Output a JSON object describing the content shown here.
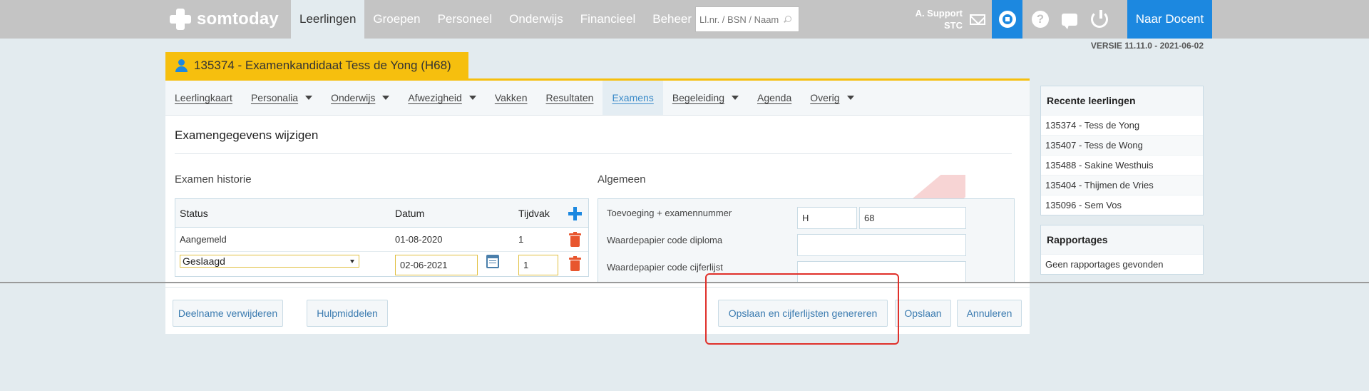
{
  "app": {
    "logo_text": "somtoday",
    "version": "VERSIE 11.11.0 - 2021-06-02"
  },
  "nav": {
    "items": [
      {
        "label": "Leerlingen",
        "active": true
      },
      {
        "label": "Groepen"
      },
      {
        "label": "Personeel"
      },
      {
        "label": "Onderwijs"
      },
      {
        "label": "Financieel"
      },
      {
        "label": "Beheer"
      }
    ]
  },
  "search": {
    "placeholder": "Ll.nr. / BSN / Naam"
  },
  "user": {
    "name": "A. Support",
    "org": "STC"
  },
  "docent_button": "Naar Docent",
  "icons": [
    "mail-icon",
    "gear-icon",
    "help-icon",
    "chat-icon",
    "power-icon",
    "person-icon",
    "plus-icon",
    "trash-icon",
    "calendar-icon"
  ],
  "colors": {
    "accent": "#1c88e0",
    "tab_yellow": "#f6bf0e",
    "delete_red": "#e8562e",
    "highlight_red": "#e0302a"
  },
  "student_tab": "135374 - Examenkandidaat Tess de Yong (H68)",
  "subnav": [
    {
      "label": "Leerlingkaart"
    },
    {
      "label": "Personalia",
      "dropdown": true
    },
    {
      "label": "Onderwijs",
      "dropdown": true
    },
    {
      "label": "Afwezigheid",
      "dropdown": true
    },
    {
      "label": "Vakken"
    },
    {
      "label": "Resultaten"
    },
    {
      "label": "Examens",
      "active": true
    },
    {
      "label": "Begeleiding",
      "dropdown": true
    },
    {
      "label": "Agenda"
    },
    {
      "label": "Overig",
      "dropdown": true
    }
  ],
  "page_title": "Examengegevens wijzigen",
  "history": {
    "title": "Examen historie",
    "headers": {
      "status": "Status",
      "datum": "Datum",
      "tijdvak": "Tijdvak"
    },
    "rows": [
      {
        "status": "Aangemeld",
        "datum": "01-08-2020",
        "tijdvak": "1"
      }
    ],
    "edit_row": {
      "status": "Geslaagd",
      "datum": "02-06-2021",
      "tijdvak": "1"
    }
  },
  "algemeen": {
    "title": "Algemeen",
    "fields": [
      {
        "label": "Toevoeging + examennummer",
        "value1": "H",
        "value2": "68"
      },
      {
        "label": "Waardepapier code diploma",
        "value": ""
      },
      {
        "label": "Waardepapier code cijferlijst",
        "value": ""
      }
    ]
  },
  "footer_buttons": {
    "delete": "Deelname verwijderen",
    "tools": "Hulpmiddelen",
    "save_generate": "Opslaan en cijferlijsten genereren",
    "save": "Opslaan",
    "cancel": "Annuleren"
  },
  "recent": {
    "title": "Recente leerlingen",
    "items": [
      "135374 - Tess de Yong",
      "135407 - Tess de Wong",
      "135488 - Sakine Westhuis",
      "135404 - Thijmen de Vries",
      "135096 - Sem Vos"
    ]
  },
  "reports": {
    "title": "Rapportages",
    "empty": "Geen rapportages gevonden"
  }
}
